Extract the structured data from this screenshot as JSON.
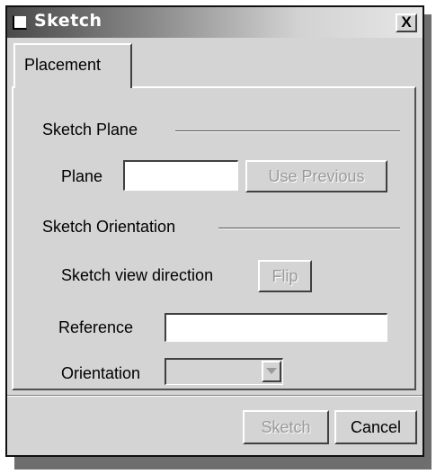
{
  "window": {
    "title": "Sketch",
    "close_label": "X"
  },
  "tabs": [
    {
      "label": "Placement",
      "active": true
    }
  ],
  "sketch_plane": {
    "group_label": "Sketch Plane",
    "plane_label": "Plane",
    "plane_value": "",
    "use_previous_label": "Use Previous",
    "use_previous_enabled": false
  },
  "sketch_orientation": {
    "group_label": "Sketch Orientation",
    "view_direction_label": "Sketch view direction",
    "flip_label": "Flip",
    "flip_enabled": false,
    "reference_label": "Reference",
    "reference_value": "",
    "orientation_label": "Orientation",
    "orientation_value": "",
    "orientation_enabled": false
  },
  "footer": {
    "sketch_label": "Sketch",
    "sketch_enabled": false,
    "cancel_label": "Cancel"
  },
  "icons": {
    "window_icon": "window-icon",
    "dropdown_arrow": "chevron-down-icon"
  },
  "colors": {
    "dialog_bg": "#d4d4d4",
    "disabled_text": "#9a9a9a",
    "title_text": "#ffffff"
  }
}
